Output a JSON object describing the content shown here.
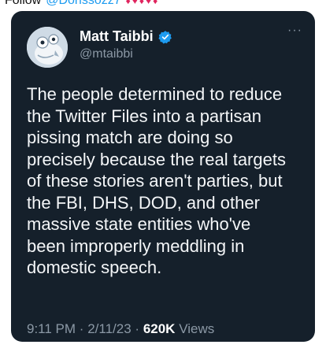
{
  "top_strip": {
    "follow_text": "Follow",
    "handle_text": "@Dorissozz7",
    "emoji_text": "♦♥♦♥♦"
  },
  "tweet": {
    "author_name": "Matt Taibbi",
    "author_handle": "@mtaibbi",
    "more_label": "···",
    "lines": [
      "The people determined to reduce",
      "the Twitter Files into a partisan",
      "pissing match are doing so",
      "precisely because the real targets",
      "of these stories aren't parties, but",
      "the FBI, DHS, DOD, and other",
      "massive state entities who've",
      "been improperly meddling in",
      "domestic speech."
    ],
    "time": "9:11 PM",
    "date": "2/11/23",
    "views_count": "620K",
    "views_label": "Views",
    "separator": "·"
  },
  "colors": {
    "card_bg": "#15202b",
    "text": "#f4f6f8",
    "secondary": "#8b98a5",
    "verified_blue": "#1d9bf0"
  }
}
